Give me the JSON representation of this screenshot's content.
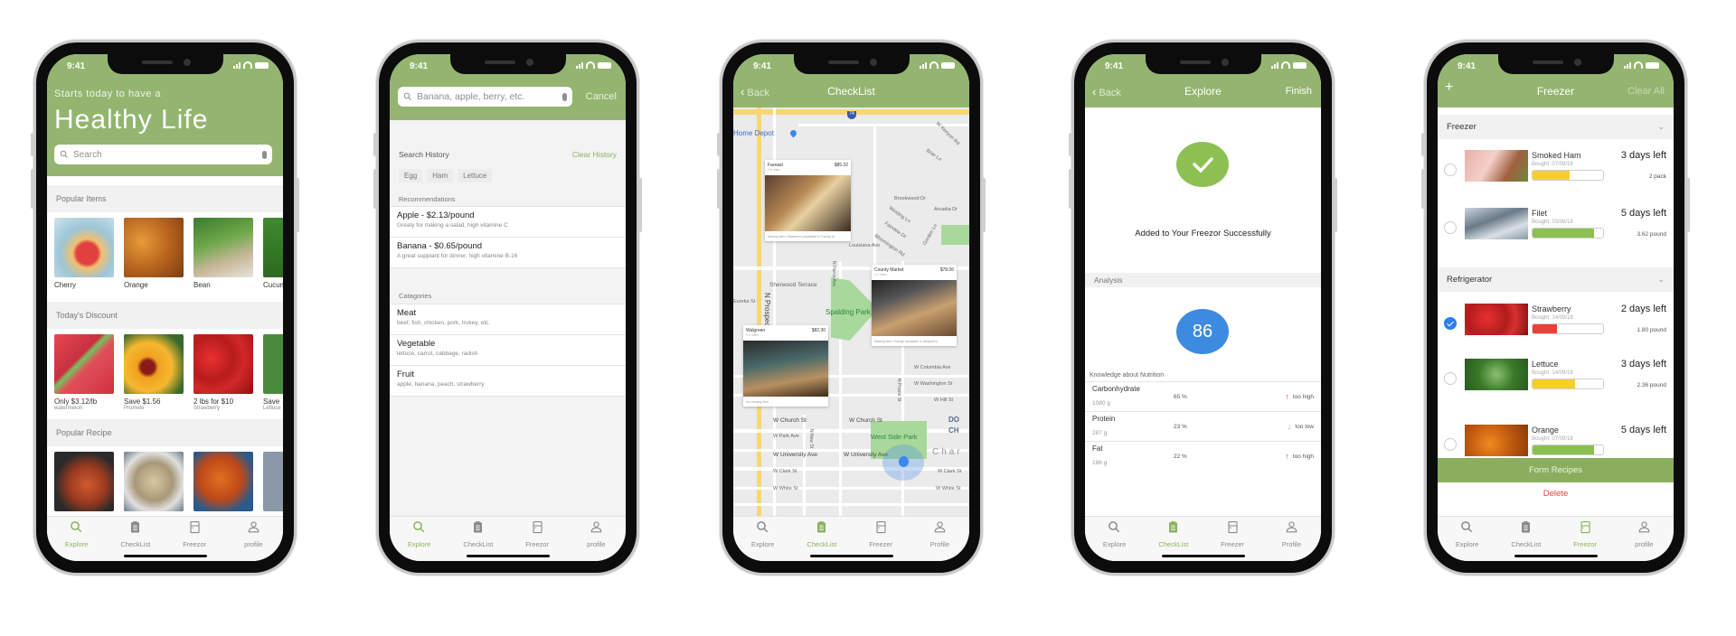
{
  "status_time": "9:41",
  "colors": {
    "primary_green": "#93b56f",
    "accent_green": "#8ab35a",
    "score_blue": "#3d8be0",
    "alert_red": "#e8413a",
    "warn_yellow": "#f7cf2a",
    "ok_green": "#8cc152"
  },
  "tab_icons": [
    "search-icon",
    "clipboard-icon",
    "fridge-icon",
    "person-icon"
  ],
  "home": {
    "subtitle": "Starts today to have a",
    "title": "Healthy Life",
    "search_placeholder": "Search",
    "sections": [
      {
        "title": "Popular Items",
        "items": [
          {
            "label": "Cherry"
          },
          {
            "label": "Orange"
          },
          {
            "label": "Bean"
          },
          {
            "label": "Cucumber"
          }
        ]
      },
      {
        "title": "Today's Discount",
        "items": [
          {
            "label": "Only $3.12/lb",
            "sub": "watermelon"
          },
          {
            "label": "Save $1.56",
            "sub": "Promelo"
          },
          {
            "label": "2 lbs for $10",
            "sub": "Strawberry"
          },
          {
            "label": "Save",
            "sub": "Lettuce"
          }
        ]
      },
      {
        "title": "Popular Recipe"
      }
    ],
    "tabs": [
      "Explore",
      "CheckList",
      "Freezor",
      "profile"
    ],
    "active_tab": 0
  },
  "search": {
    "placeholder": "Banana, apple, berry, etc.",
    "cancel": "Cancel",
    "history_title": "Search History",
    "clear_history": "Clear History",
    "history": [
      "Egg",
      "Ham",
      "Lettuce"
    ],
    "recommendations_title": "Recommendations",
    "recommendations": [
      {
        "title": "Apple - $2.13/pound",
        "desc": "Greaty for making a salad, high vitamine C"
      },
      {
        "title": "Banana - $0.65/pound",
        "desc": "A great supplant for dinner, high vitamine B-16"
      }
    ],
    "categories_title": "Catagories",
    "categories": [
      {
        "title": "Meat",
        "desc": "beef, fish, chicken, pork, trukey, etc."
      },
      {
        "title": "Vegetable",
        "desc": "lettuce, carrot, cabbage, radish"
      },
      {
        "title": "Fruit",
        "desc": "apple, banana, peach, strawberry"
      }
    ],
    "tabs": [
      "Explore",
      "CheckList",
      "Freezor",
      "profile"
    ],
    "active_tab": 0
  },
  "checklist": {
    "back": "Back",
    "title": "CheckList",
    "map_labels": [
      "Home Depot",
      "Sherwood Terrace",
      "N Prospect",
      "Spalding Park",
      "N Harris Ave",
      "Brookwood Dr",
      "Winding Ln",
      "Arcadia Dr",
      "Fairview Dr",
      "Bloomington Rd",
      "Garden Ln",
      "Louisiana Ave",
      "W Kenyon Rd",
      "Briar Ln",
      "Eureka St",
      "W Columbia Ave",
      "W Washington St",
      "W Hill St",
      "N Prairie St",
      "W Church St",
      "W Church St",
      "W Park Ave",
      "N New St",
      "West Side Park",
      "W University Ave",
      "W University Ave",
      "W Clark St",
      "W Clark St",
      "W White St",
      "W White St",
      "DO",
      "CH",
      "Char",
      "74"
    ],
    "stores": [
      {
        "name": "Fareast",
        "price": "$85.32",
        "distance": "2.6 miles",
        "note": "Missing item: Strawberry (available in County M"
      },
      {
        "name": "County Market",
        "price": "$78.06",
        "distance": "1.1 miles",
        "note": "Missing item: Orange (available in Walgreen)"
      },
      {
        "name": "Walgreen",
        "price": "$82.30",
        "distance": "0.9 miles",
        "note": "No missing item"
      }
    ],
    "tabs": [
      "Explore",
      "CheckList",
      "Freezer",
      "Profile"
    ],
    "active_tab": 1
  },
  "explore": {
    "back": "Back",
    "title": "Explore",
    "finish": "Finish",
    "success_message": "Added to Your Freezor Successfully",
    "analysis_title": "Analysis",
    "score": "86",
    "nutrition_title": "Knowledge about Nutrition",
    "nutrition": [
      {
        "name": "Carbonhydrate",
        "amount": "1080 g",
        "percent": "65 %",
        "status": "too high",
        "direction": "up"
      },
      {
        "name": "Protein",
        "amount": "287 g",
        "percent": "23 %",
        "status": "too low",
        "direction": "down"
      },
      {
        "name": "Fat",
        "amount": "186 g",
        "percent": "22 %",
        "status": "too high",
        "direction": "up"
      }
    ],
    "tabs": [
      "Explore",
      "CheckList",
      "Freezer",
      "Profile"
    ],
    "active_tab": 1
  },
  "freezer": {
    "add": "+",
    "title": "Freezer",
    "clear_all": "Clear All",
    "sections": [
      {
        "title": "Freezer",
        "items": [
          {
            "name": "Smoked Ham",
            "bought": "Bought: 07/09/18",
            "days_left": "3 days left",
            "quantity": "2 pack",
            "freshness": 0.53,
            "bar_color": "#f7cf2a",
            "checked": false
          },
          {
            "name": "Filet",
            "bought": "Bought: 03/06/18",
            "days_left": "5 days left",
            "quantity": "3.62 pound",
            "freshness": 0.87,
            "bar_color": "#8cc152",
            "checked": false
          }
        ]
      },
      {
        "title": "Refrigerator",
        "items": [
          {
            "name": "Strawberry",
            "bought": "Bought: 14/09/18",
            "days_left": "2 days left",
            "quantity": "1.80 pound",
            "freshness": 0.35,
            "bar_color": "#e8413a",
            "checked": true
          },
          {
            "name": "Lettuce",
            "bought": "Bought: 14/09/18",
            "days_left": "3 days left",
            "quantity": "2.36 pound",
            "freshness": 0.6,
            "bar_color": "#f7cf2a",
            "checked": false
          },
          {
            "name": "Orange",
            "bought": "Bought: 07/09/18",
            "days_left": "5 days left",
            "freshness": 0.87,
            "bar_color": "#8cc152",
            "checked": false
          }
        ]
      }
    ],
    "form_recipes": "Form Recipes",
    "delete": "Delete",
    "tabs": [
      "Explore",
      "CheckList",
      "Freezor",
      "profile"
    ],
    "active_tab": 2
  }
}
